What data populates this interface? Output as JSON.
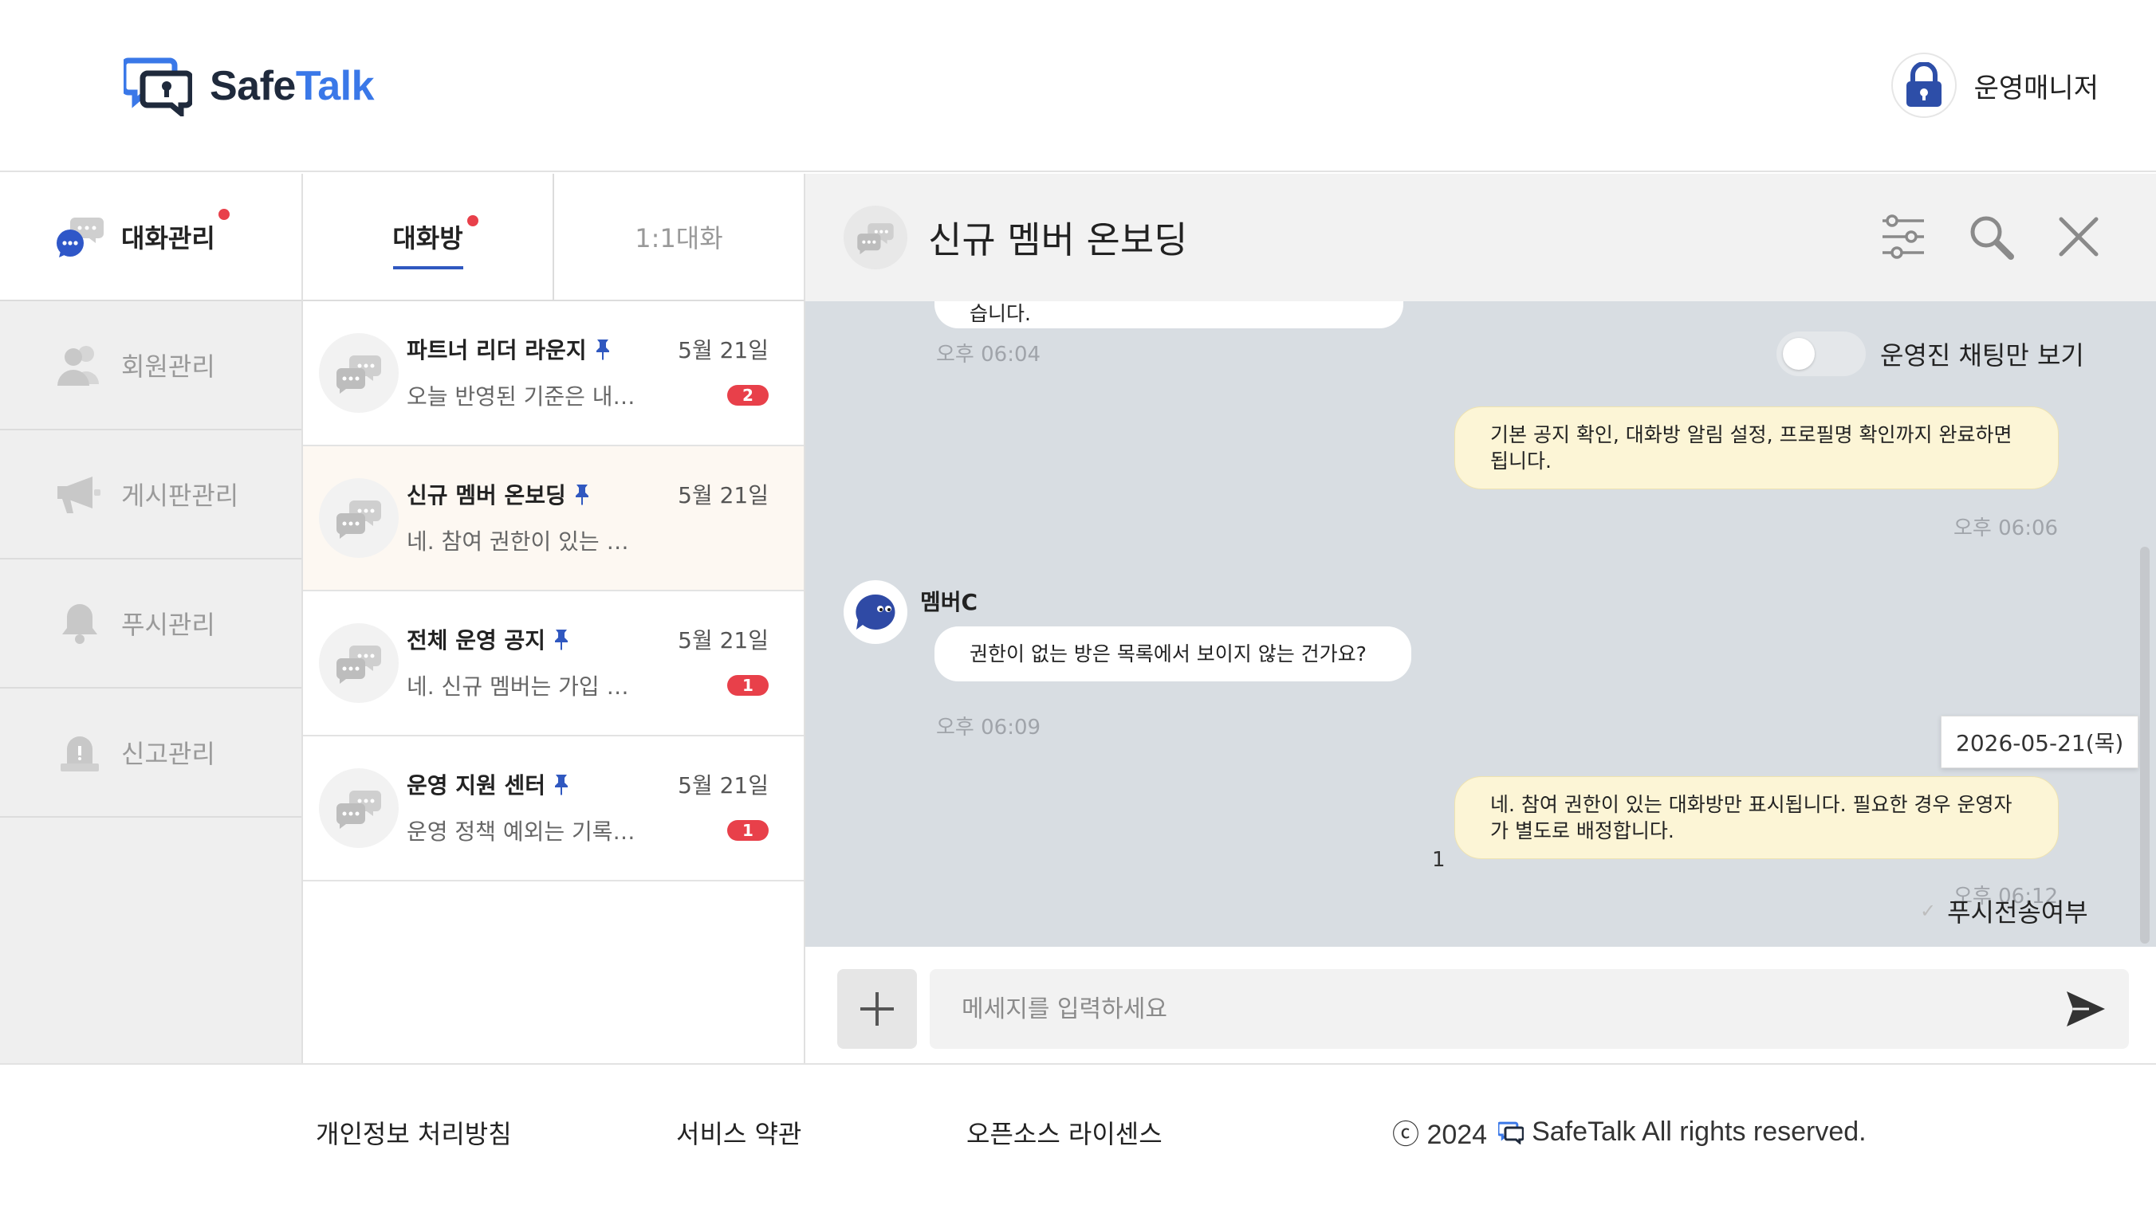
{
  "header": {
    "logo_safe": "Safe",
    "logo_talk": "Talk",
    "admin_name": "운영매니저"
  },
  "nav": {
    "items": [
      {
        "label": "대화관리",
        "icon": "chat-bubbles-icon",
        "active": true,
        "dot": true
      },
      {
        "label": "회원관리",
        "icon": "users-icon"
      },
      {
        "label": "게시판관리",
        "icon": "megaphone-icon"
      },
      {
        "label": "푸시관리",
        "icon": "bell-icon"
      },
      {
        "label": "신고관리",
        "icon": "siren-icon"
      }
    ]
  },
  "rooms": {
    "tabs": [
      {
        "label": "대화방",
        "active": true
      },
      {
        "label": "1:1대화"
      }
    ],
    "list": [
      {
        "name": "파트너 리더 라운지",
        "date": "5월 21일",
        "preview": "오늘 반영된 기준은 내…",
        "badge": "2"
      },
      {
        "name": "신규 멤버 온보딩",
        "date": "5월 21일",
        "preview": "네. 참여 권한이 있는 …",
        "badge": ""
      },
      {
        "name": "전체 운영 공지",
        "date": "5월 21일",
        "preview": "네. 신규 멤버는 가입 …",
        "badge": "1"
      },
      {
        "name": "운영 지원 센터",
        "date": "5월 21일",
        "preview": "운영 정책 예외는 기록…",
        "badge": "1"
      }
    ]
  },
  "chat": {
    "title": "신규 멤버 온보딩",
    "partial_bubble": "기본 공지 확인은 대화방 상단에서 확인할 수 있습니다.",
    "partial_time": "오후 06:04",
    "toggle_label": "운영진 채팅만 보기",
    "toggle_on": false,
    "msg_out_1": "기본 공지 확인, 대화방 알림 설정, 프로필명 확인까지 완료하면 됩니다.",
    "msg_out_1_time": "오후 06:06",
    "member_name": "멤버C",
    "msg_in_1": "권한이 없는 방은 목록에서 보이지 않는 건가요?",
    "msg_in_1_time": "오후 06:09",
    "date_tip": "2026-05-21(목)",
    "msg_out_2": "네. 참여 권한이 있는 대화방만 표시됩니다. 필요한 경우 운영자가 별도로 배정합니다.",
    "msg_out_2_time": "오후 06:12",
    "read_count": "1",
    "push_sent_label": "푸시전송여부",
    "input_placeholder": "메세지를 입력하세요"
  },
  "footer": {
    "privacy": "개인정보 처리방침",
    "terms": "서비스 약관",
    "oss": "오픈소스 라이센스",
    "copy_prefix": "ⓒ 2024",
    "copy_suffix": "SafeTalk All rights reserved."
  },
  "colors": {
    "accent": "#3058c0",
    "brand_blue": "#3a78e8",
    "badge_red": "#e8404a",
    "bubble_out": "#fcf5d6",
    "chat_bg": "#d8dde2"
  }
}
